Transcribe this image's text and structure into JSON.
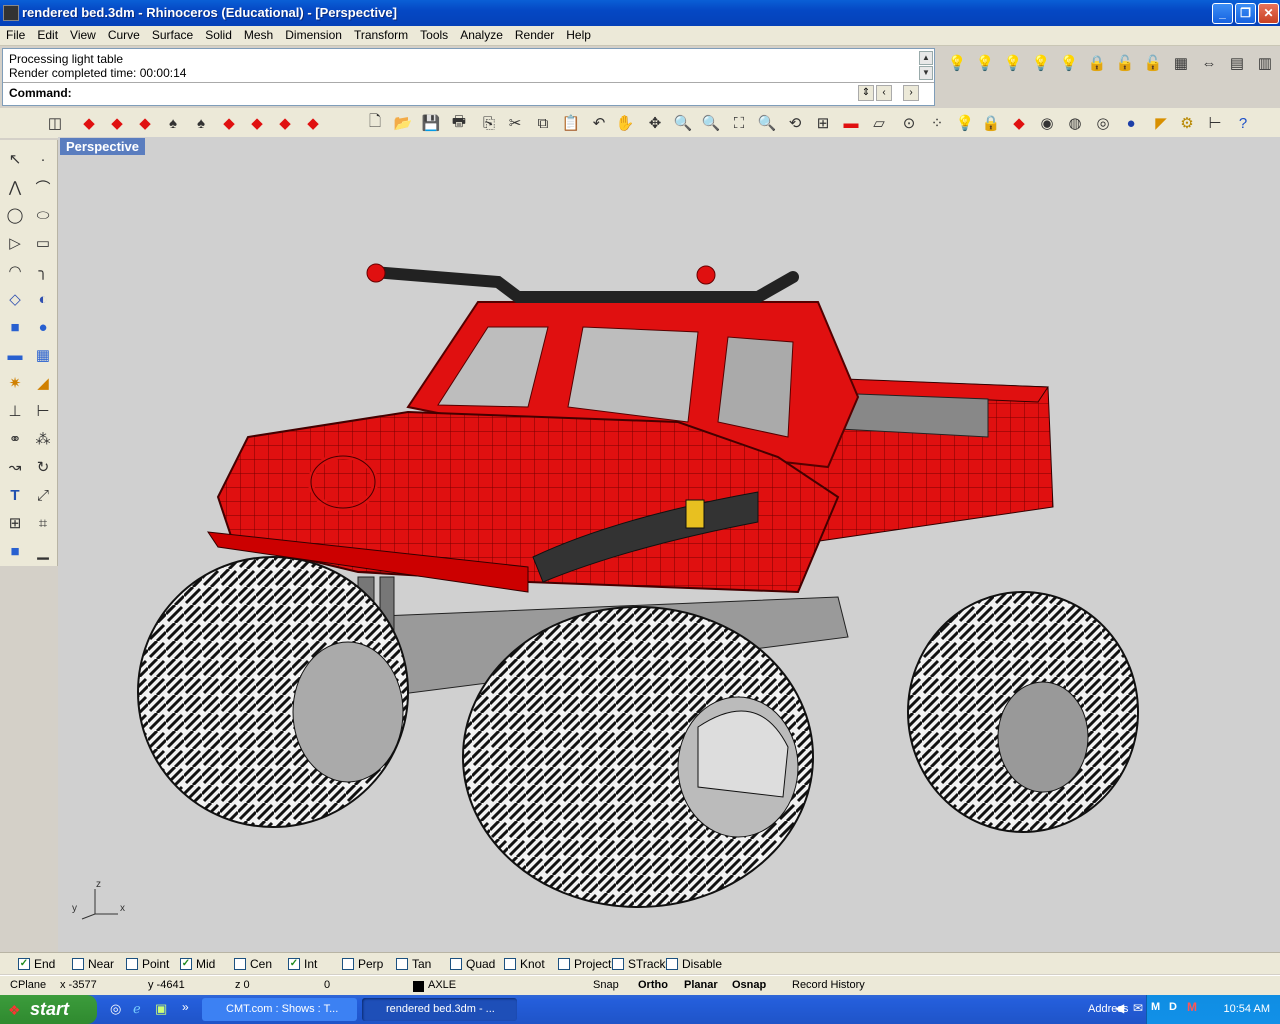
{
  "window": {
    "title": "rendered bed.3dm - Rhinoceros (Educational) - [Perspective]"
  },
  "menu": [
    "File",
    "Edit",
    "View",
    "Curve",
    "Surface",
    "Solid",
    "Mesh",
    "Dimension",
    "Transform",
    "Tools",
    "Analyze",
    "Render",
    "Help"
  ],
  "command": {
    "history": [
      "Processing light table",
      "Render completed time: 00:00:14"
    ],
    "prompt": "Command:"
  },
  "viewport": {
    "title": "Perspective",
    "axes": {
      "x": "x",
      "y": "y",
      "z": "z"
    }
  },
  "osnaps": [
    {
      "label": "End",
      "checked": true
    },
    {
      "label": "Near",
      "checked": false
    },
    {
      "label": "Point",
      "checked": false
    },
    {
      "label": "Mid",
      "checked": true
    },
    {
      "label": "Cen",
      "checked": false
    },
    {
      "label": "Int",
      "checked": true
    },
    {
      "label": "Perp",
      "checked": false
    },
    {
      "label": "Tan",
      "checked": false
    },
    {
      "label": "Quad",
      "checked": false
    },
    {
      "label": "Knot",
      "checked": false
    },
    {
      "label": "Project",
      "checked": false
    },
    {
      "label": "STrack",
      "checked": false
    },
    {
      "label": "Disable",
      "checked": false
    }
  ],
  "status": {
    "cplane": "CPlane",
    "x": "x -3577",
    "y": "y -4641",
    "z": "z 0",
    "extra": "0",
    "layer": "AXLE",
    "snap": "Snap",
    "ortho": "Ortho",
    "planar": "Planar",
    "osnap": "Osnap",
    "record": "Record History"
  },
  "taskbar": {
    "start": "start",
    "items": [
      "CMT.com : Shows : T...",
      "rendered bed.3dm - ..."
    ],
    "address": "Address",
    "clock": "10:54 AM"
  },
  "colors": {
    "model_red": "#e01010",
    "title_blue": "#0548c4",
    "viewport_bg": "#d0d0d0"
  }
}
